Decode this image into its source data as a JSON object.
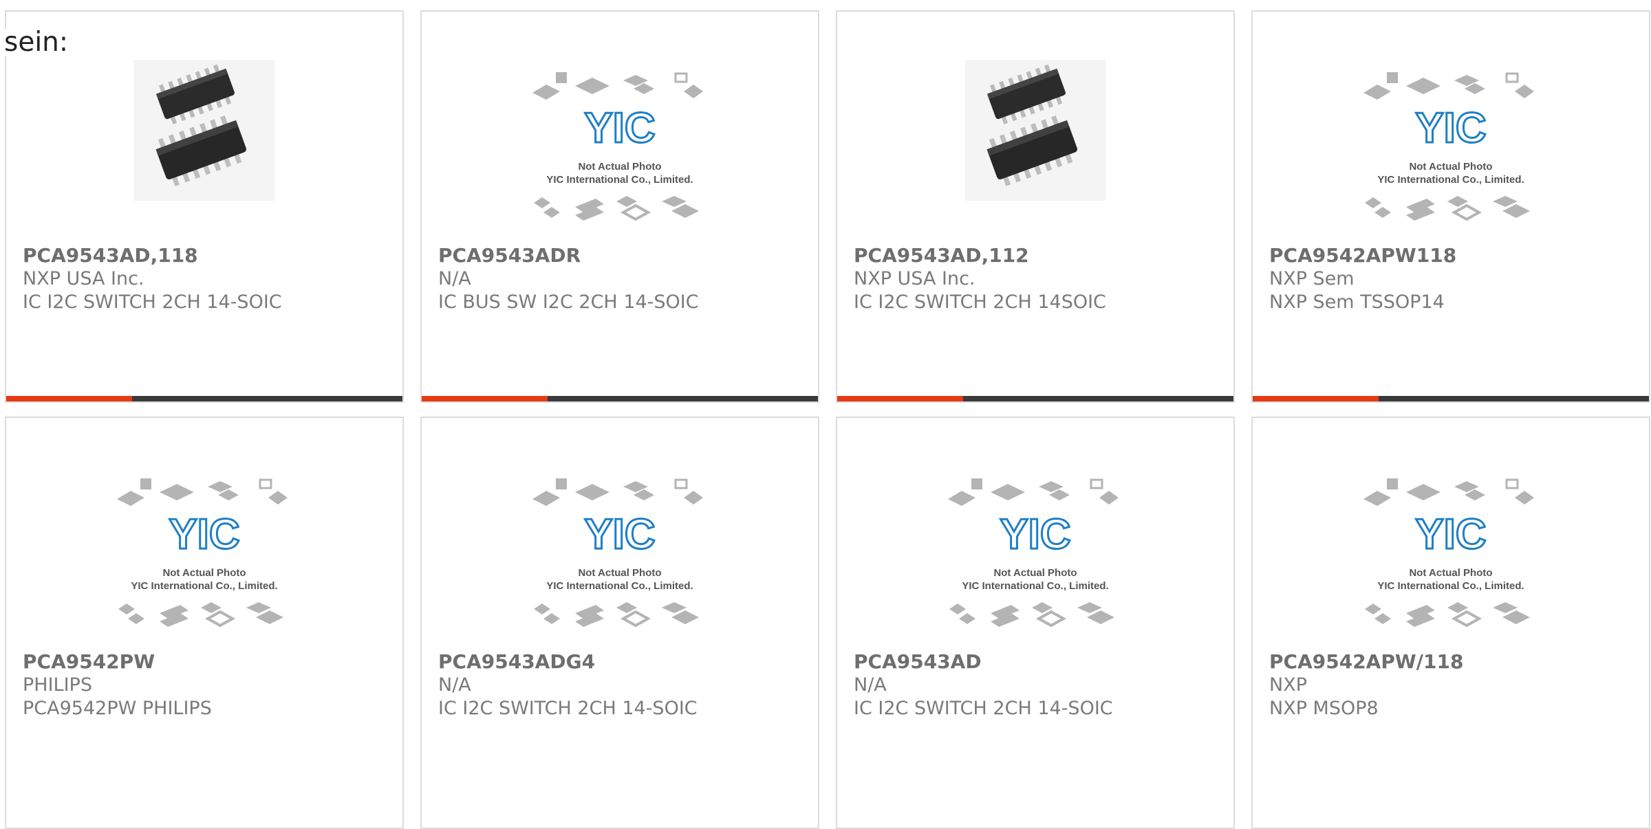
{
  "intro_text": "sein:",
  "products": [
    {
      "part": "PCA9543AD,118",
      "manufacturer": "NXP USA Inc.",
      "description": "IC I2C SWITCH 2CH 14-SOIC",
      "image": "soic-chip-photo"
    },
    {
      "part": "PCA9543ADR",
      "manufacturer": "N/A",
      "description": "IC BUS SW I2C 2CH 14-SOIC",
      "image": "yic-placeholder"
    },
    {
      "part": "PCA9543AD,112",
      "manufacturer": "NXP USA Inc.",
      "description": "IC I2C SWITCH 2CH 14SOIC",
      "image": "soic-chip-photo"
    },
    {
      "part": "PCA9542APW118",
      "manufacturer": "NXP Sem",
      "description": "NXP Sem TSSOP14",
      "image": "yic-placeholder"
    },
    {
      "part": "PCA9542PW",
      "manufacturer": "PHILIPS",
      "description": "PCA9542PW PHILIPS",
      "image": "yic-placeholder"
    },
    {
      "part": "PCA9543ADG4",
      "manufacturer": "N/A",
      "description": "IC I2C SWITCH 2CH 14-SOIC",
      "image": "yic-placeholder"
    },
    {
      "part": "PCA9543AD",
      "manufacturer": "N/A",
      "description": "IC I2C SWITCH 2CH 14-SOIC",
      "image": "yic-placeholder"
    },
    {
      "part": "PCA9542APW/118",
      "manufacturer": "NXP",
      "description": "NXP MSOP8",
      "image": "yic-placeholder"
    }
  ],
  "placeholder": {
    "line1": "Not Actual Photo",
    "line2": "YIC International Co., Limited."
  },
  "colors": {
    "accent": "#e53a14",
    "bar": "#3a3a3a",
    "border": "#dcdcdc",
    "logo_blue": "#1f7fc4"
  }
}
